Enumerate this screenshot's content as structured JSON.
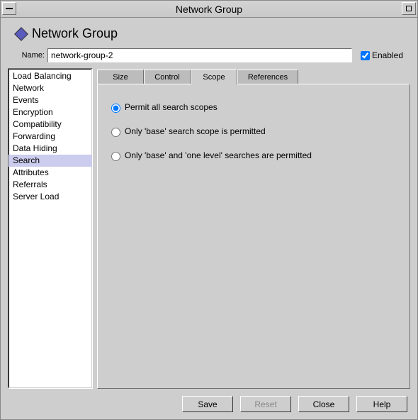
{
  "window": {
    "title": "Network Group"
  },
  "header": {
    "title": "Network Group"
  },
  "name": {
    "label": "Name:",
    "value": "network-group-2",
    "enabled_label": "Enabled",
    "enabled_checked": true
  },
  "categories": [
    "Load Balancing",
    "Network",
    "Events",
    "Encryption",
    "Compatibility",
    "Forwarding",
    "Data Hiding",
    "Search",
    "Attributes",
    "Referrals",
    "Server Load"
  ],
  "selected_category_index": 7,
  "tabs": [
    "Size",
    "Control",
    "Scope",
    "References"
  ],
  "selected_tab_index": 2,
  "scope": {
    "options": [
      "Permit all search scopes",
      "Only 'base' search scope is permitted",
      "Only 'base' and 'one level' searches are permitted"
    ],
    "selected": 0
  },
  "buttons": {
    "save": "Save",
    "reset": "Reset",
    "close": "Close",
    "help": "Help"
  }
}
